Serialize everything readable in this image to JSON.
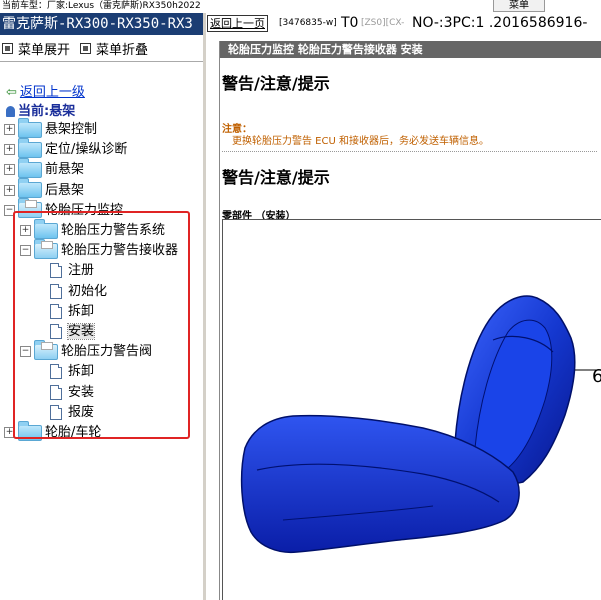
{
  "topbar": {
    "vehicle_label": "当前车型：",
    "vehicle_value": "厂家:Lexus（雷克萨斯)RX350h2022",
    "menu_button": "菜单"
  },
  "left": {
    "model_title": "雷克萨斯-RX300-RX350-RX3",
    "expand_menu": "菜单展开",
    "collapse_menu": "菜单折叠",
    "back_link": "返回上一级",
    "current_prefix": "当前:",
    "current_section": "悬架",
    "tree": [
      {
        "label": "悬架控制",
        "expander": "+",
        "type": "folder"
      },
      {
        "label": "定位/操纵诊断",
        "expander": "+",
        "type": "folder"
      },
      {
        "label": "前悬架",
        "expander": "+",
        "type": "folder"
      },
      {
        "label": "后悬架",
        "expander": "+",
        "type": "folder"
      },
      {
        "label": "轮胎压力监控",
        "expander": "−",
        "type": "open-folder"
      },
      {
        "label": "轮胎压力警告系统",
        "expander": "+",
        "type": "folder"
      },
      {
        "label": "轮胎压力警告接收器",
        "expander": "−",
        "type": "open-folder"
      },
      {
        "label": "注册",
        "type": "doc"
      },
      {
        "label": "初始化",
        "type": "doc"
      },
      {
        "label": "拆卸",
        "type": "doc"
      },
      {
        "label": "安装",
        "type": "doc",
        "selected": true
      },
      {
        "label": "轮胎压力警告阀",
        "expander": "−",
        "type": "open-folder"
      },
      {
        "label": "拆卸",
        "type": "doc"
      },
      {
        "label": "安装",
        "type": "doc"
      },
      {
        "label": "报废",
        "type": "doc"
      },
      {
        "label": "轮胎/车轮",
        "expander": "+",
        "type": "folder"
      }
    ]
  },
  "right": {
    "back_button": "返回上一页",
    "doc_id": "[3476835-w]",
    "t0": "T0",
    "zs": "[ZS0][CX-",
    "nopc": "NO-:3PC:1 .2016586916-",
    "breadcrumb": "轮胎压力监控  轮胎压力警告接收器  安装",
    "heading_1": "警告/注意/提示",
    "note_label": "注意：",
    "note_text": "更换轮胎压力警告 ECU 和接收器后，务必发送车辆信息。",
    "heading_2": "警告/注意/提示",
    "parts_label": "零部件 （安装）",
    "callout_partial": "6"
  },
  "colors": {
    "title_bar": "#1b3d73",
    "highlight_box": "#e02424",
    "link": "#0033cc",
    "note": "#c06000",
    "seat": "#1538d0"
  }
}
